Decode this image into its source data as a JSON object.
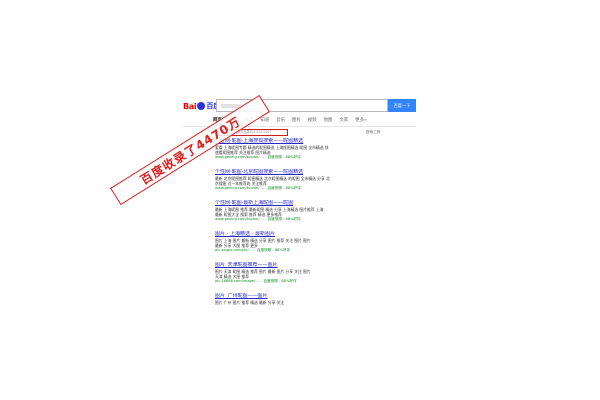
{
  "header": {
    "logo": {
      "bai": "Bai",
      "du": "百度"
    },
    "search_button": "百度一下"
  },
  "tabs": [
    "网页",
    "新闻",
    "贴吧",
    "知道",
    "音乐",
    "图片",
    "视频",
    "地图",
    "文库",
    "更多»"
  ],
  "result_count": "百度为您找到相关结果约4,470,000个",
  "search_tools": "搜索工具",
  "results": [
    {
      "title": "个性网·昵图·上海搜狐搜索——昵图精选",
      "lines": [
        "爱看 上海昵图专题 精选的昵图精选 上海搜图精选 昵图 全市精选 快",
        "速看昵图推荐 关注推荐 图片精选"
      ],
      "url": "www.gexing.com/tupian/ ... - 百度快照 - 88%好评"
    },
    {
      "title": "个性网·昵图·北京昵图搜索——昵图精选",
      "lines": [
        "最新 北京昵图推荐 昵图精选 北京昵图精选 的昵图 全市精选 分享 北",
        "京搜图 近一年推荐的 关注推荐"
      ],
      "url": "www.gexing.com/tupian/ ... - 百度快照 - 88%好评"
    },
    {
      "title": "个性网·昵图·最新上海昵图——昵图",
      "lines": [
        "最新 上海昵图 推荐 最新昵图 精选 分享 上海精选 图片推荐 上海",
        "最新 昵图大全 搜索 推荐 精选 更多推荐"
      ],
      "url": "www.gexing.com/tupian/ ... - 百度快照 - 88%好评"
    },
    {
      "title": "图片 - 上海精选 - 最新图片",
      "lines": [
        "图片 上海 图片 最新 精选 分享 图片 推荐 关注 图片 图片",
        "最新 分享 大图 推荐 更多"
      ],
      "url": "pic.sogou.com/pic/ ... - 百度快照 - 88%好评"
    },
    {
      "title": "图片_天津昵图推荐——图片",
      "lines": [
        "图片 天津 昵图 精选 推荐 图片 最新 图片 分享 关注 图片",
        "天津 精选 大图 推荐"
      ],
      "url": "pic.16888.com/image/ ... - 百度快照 - 88%好评"
    },
    {
      "title": "图片_广州昵图——图片",
      "lines": [
        "图片 广州 图片 推荐 精选 最新 分享 关注"
      ],
      "url": ""
    }
  ],
  "stamp_text": "百度收录了4470万"
}
